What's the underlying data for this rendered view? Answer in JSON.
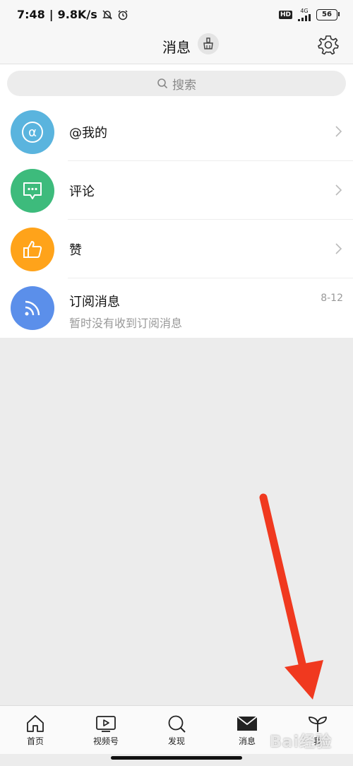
{
  "status_bar": {
    "time": "7:48",
    "speed": "9.8K/s",
    "hd_badge": "HD",
    "network": "4G",
    "battery": "56"
  },
  "header": {
    "title": "消息"
  },
  "search": {
    "placeholder": "搜索"
  },
  "messages": [
    {
      "label": "@我的",
      "icon": "at-icon",
      "color": "#5ab4de"
    },
    {
      "label": "评论",
      "icon": "comment-icon",
      "color": "#3dbb7c"
    },
    {
      "label": "赞",
      "icon": "thumbs-up-icon",
      "color": "#ffa31a"
    },
    {
      "label": "订阅消息",
      "sublabel": "暂时没有收到订阅消息",
      "date": "8-12",
      "icon": "rss-icon",
      "color": "#5b8fea"
    }
  ],
  "bottom_nav": {
    "items": [
      {
        "label": "首页",
        "icon": "home-icon"
      },
      {
        "label": "视频号",
        "icon": "video-icon"
      },
      {
        "label": "发现",
        "icon": "discover-icon"
      },
      {
        "label": "消息",
        "icon": "mail-icon",
        "active": true
      },
      {
        "label": "我",
        "icon": "sprout-icon"
      }
    ]
  },
  "accent_colors": {
    "annotation_arrow": "#f0391f"
  }
}
